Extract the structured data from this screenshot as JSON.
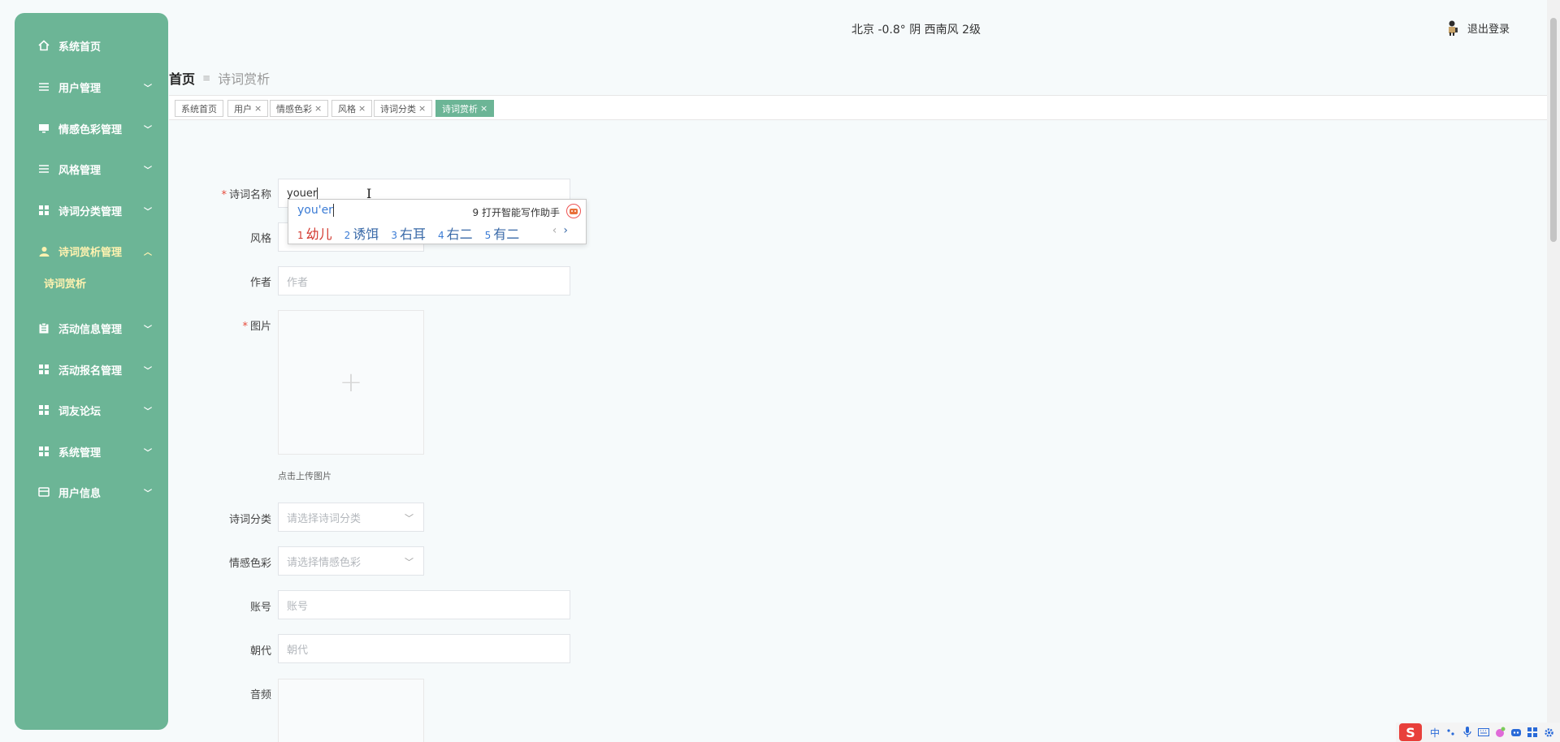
{
  "sidebar": {
    "items": [
      {
        "label": "系统首页",
        "icon": "home-icon",
        "has_arrow": false
      },
      {
        "label": "用户管理",
        "icon": "list-icon",
        "has_arrow": true
      },
      {
        "label": "情感色彩管理",
        "icon": "monitor-icon",
        "has_arrow": true
      },
      {
        "label": "风格管理",
        "icon": "list-icon",
        "has_arrow": true
      },
      {
        "label": "诗词分类管理",
        "icon": "grid-icon",
        "has_arrow": true
      },
      {
        "label": "诗词赏析管理",
        "icon": "user-icon",
        "has_arrow": true,
        "expanded": true
      },
      {
        "label": "活动信息管理",
        "icon": "clipboard-icon",
        "has_arrow": true
      },
      {
        "label": "活动报名管理",
        "icon": "grid-icon",
        "has_arrow": true
      },
      {
        "label": "词友论坛",
        "icon": "grid-icon",
        "has_arrow": true
      },
      {
        "label": "系统管理",
        "icon": "grid-icon",
        "has_arrow": true
      },
      {
        "label": "用户信息",
        "icon": "card-icon",
        "has_arrow": true
      }
    ],
    "submenu": {
      "label": "诗词赏析"
    }
  },
  "header": {
    "weather": "北京  -0.8°  阴  西南风  2级",
    "logout_label": "退出登录"
  },
  "breadcrumb": {
    "home": "首页",
    "current": "诗词赏析"
  },
  "tags": [
    {
      "label": "系统首页",
      "closable": false
    },
    {
      "label": "用户",
      "closable": true
    },
    {
      "label": "情感色彩",
      "closable": true
    },
    {
      "label": "风格",
      "closable": true
    },
    {
      "label": "诗词分类",
      "closable": true
    },
    {
      "label": "诗词赏析",
      "closable": true,
      "active": true
    }
  ],
  "form": {
    "name_label": "诗词名称",
    "name_value": "youer",
    "style_label": "风格",
    "author_label": "作者",
    "author_placeholder": "作者",
    "image_label": "图片",
    "upload_tip": "点击上传图片",
    "category_label": "诗词分类",
    "category_placeholder": "请选择诗词分类",
    "emotion_label": "情感色彩",
    "emotion_placeholder": "请选择情感色彩",
    "account_label": "账号",
    "account_placeholder": "账号",
    "dynasty_label": "朝代",
    "dynasty_placeholder": "朝代",
    "audio_label": "音频",
    "required_mark": "*"
  },
  "ime": {
    "pinyin": "you'er",
    "assist": "9 打开智能写作助手",
    "candidates": [
      {
        "n": "1",
        "text": "幼儿"
      },
      {
        "n": "2",
        "text": "诱饵"
      },
      {
        "n": "3",
        "text": "右耳"
      },
      {
        "n": "4",
        "text": "右二"
      },
      {
        "n": "5",
        "text": "有二"
      }
    ],
    "prev": "‹",
    "next": "›"
  },
  "tray": {
    "ime_mode": "中"
  },
  "colors": {
    "accent": "#6cb596",
    "active_menu": "#fff2b0",
    "required": "#e74c3c"
  }
}
